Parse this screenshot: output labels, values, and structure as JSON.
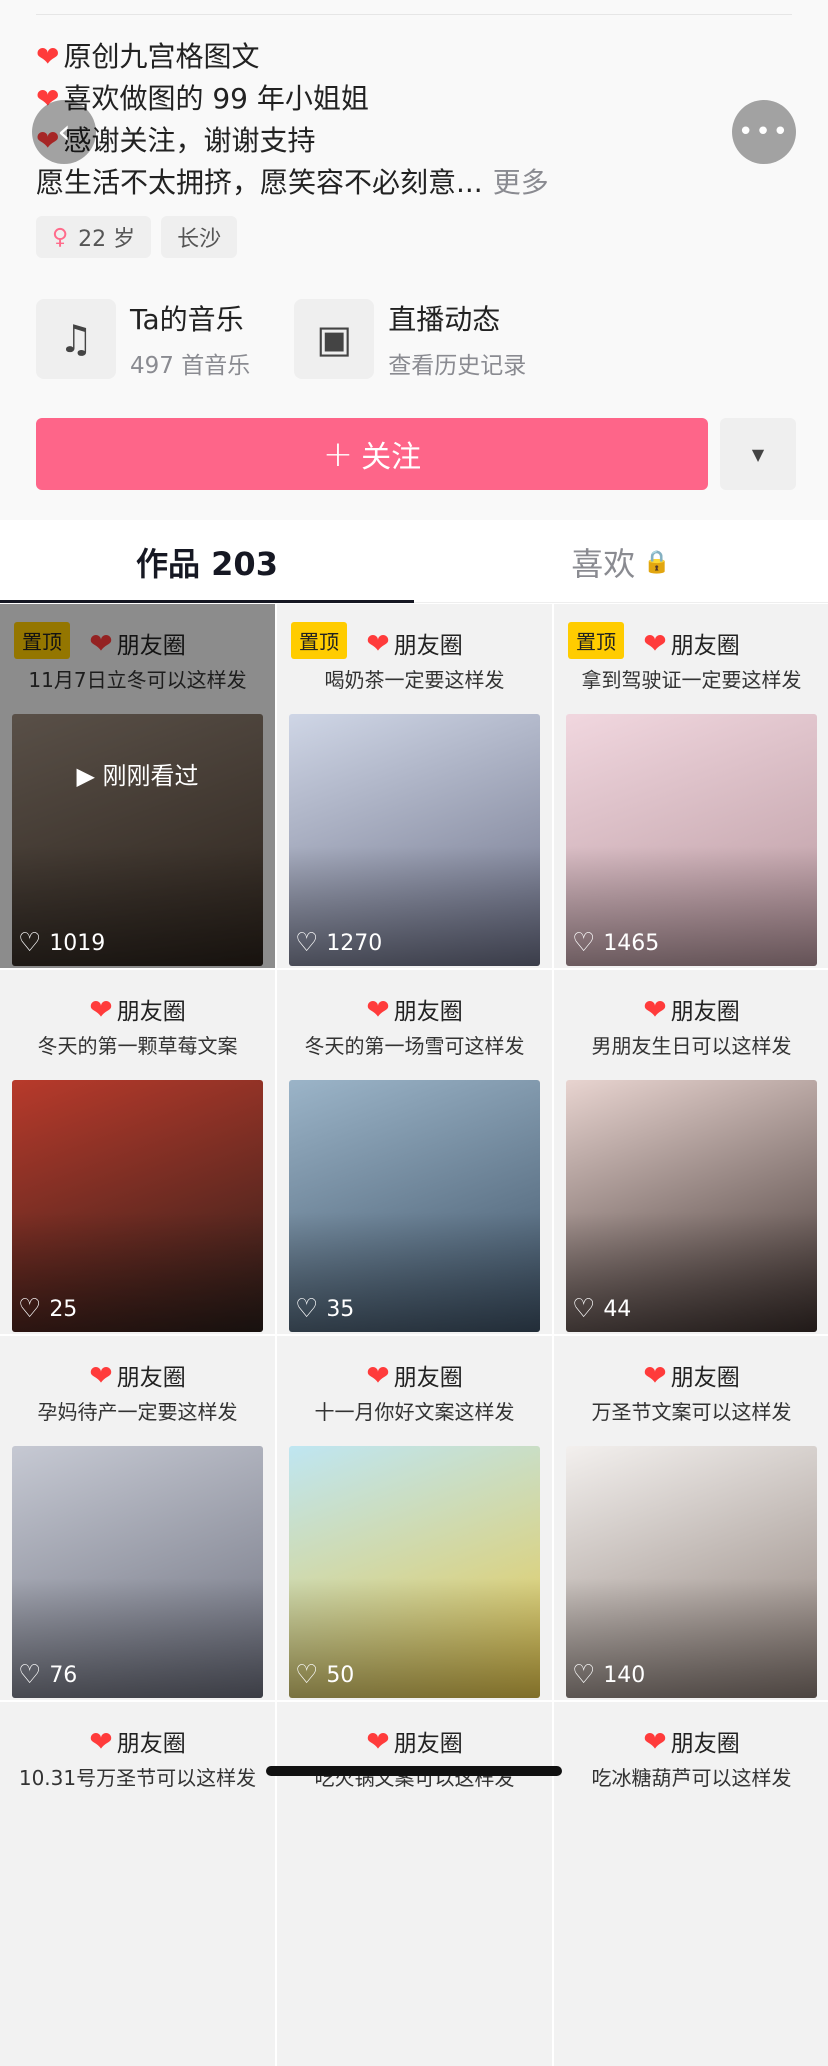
{
  "profile": {
    "bio_lines": [
      {
        "icon": "heart-icon",
        "text": "原创九宫格图文"
      },
      {
        "icon": "heart-icon",
        "text": "喜欢做图的 99 年小姐姐"
      },
      {
        "icon": "heart-icon",
        "text": "感谢关注，谢谢支持"
      },
      {
        "text": "愿生活不太拥挤，愿笑容不必刻意..."
      }
    ],
    "more_label": "更多",
    "tags": [
      {
        "icon": "female-icon",
        "text": "22 岁"
      },
      {
        "text": "长沙"
      }
    ],
    "cards": [
      {
        "icon": "music-icon",
        "title": "Ta的音乐",
        "subtitle": "497 首音乐"
      },
      {
        "icon": "live-tv-icon",
        "title": "直播动态",
        "subtitle": "查看历史记录"
      }
    ],
    "follow_label": "关注"
  },
  "tabs": [
    {
      "label": "作品 203",
      "active": true
    },
    {
      "label": "喜欢",
      "icon": "lock-icon",
      "active": false
    }
  ],
  "posts": [
    {
      "tag": "朋友圈",
      "caption": "11月7日立冬可以这样发",
      "likes": "1019",
      "pinned": "置顶",
      "viewed": "刚刚看过",
      "colors": [
        "#9a8a7c",
        "#4a3b2f"
      ]
    },
    {
      "tag": "朋友圈",
      "caption": "喝奶茶一定要这样发",
      "likes": "1270",
      "pinned": "置顶",
      "colors": [
        "#cfd6e6",
        "#6b6f86"
      ]
    },
    {
      "tag": "朋友圈",
      "caption": "拿到驾驶证一定要这样发",
      "likes": "1465",
      "pinned": "置顶",
      "colors": [
        "#f1d7df",
        "#b6969d"
      ]
    },
    {
      "tag": "朋友圈",
      "caption": "冬天的第一颗草莓文案",
      "likes": "25",
      "colors": [
        "#b83a2b",
        "#2a1e1a"
      ]
    },
    {
      "tag": "朋友圈",
      "caption": "冬天的第一场雪可这样发",
      "likes": "35",
      "colors": [
        "#9bb4c8",
        "#3e5266"
      ]
    },
    {
      "tag": "朋友圈",
      "caption": "男朋友生日可以这样发",
      "likes": "44",
      "colors": [
        "#e8d4d0",
        "#3b2f2c"
      ]
    },
    {
      "tag": "朋友圈",
      "caption": "孕妈待产一定要这样发",
      "likes": "76",
      "colors": [
        "#c6c9d3",
        "#6c6f7d"
      ]
    },
    {
      "tag": "朋友圈",
      "caption": "十一月你好文案这样发",
      "likes": "50",
      "colors": [
        "#bfe6f2",
        "#e8c84a"
      ]
    },
    {
      "tag": "朋友圈",
      "caption": "万圣节文案可以这样发",
      "likes": "140",
      "colors": [
        "#f3f0ee",
        "#8b7d76"
      ]
    },
    {
      "tag": "朋友圈",
      "caption": "10.31号万圣节可以这样发"
    },
    {
      "tag": "朋友圈",
      "caption": "吃火锅文案可以这样发"
    },
    {
      "tag": "朋友圈",
      "caption": "吃冰糖葫芦可以这样发"
    }
  ]
}
